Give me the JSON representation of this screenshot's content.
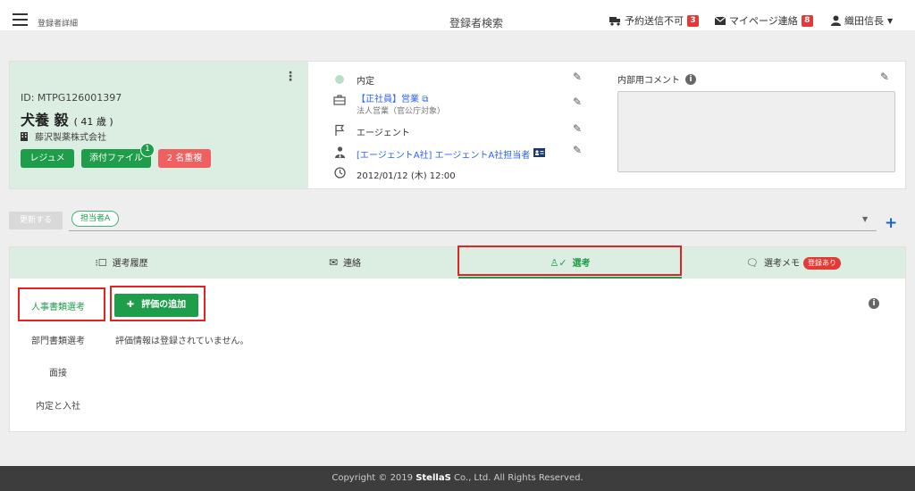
{
  "header": {
    "breadcrumb": "登録者詳細",
    "center_title": "登録者検索",
    "reservation_label": "予約送信不可",
    "reservation_count": "3",
    "mypage_label": "マイページ連絡",
    "mypage_count": "8",
    "user_name": "織田信長"
  },
  "profile": {
    "id": "ID: MTPG126001397",
    "name": "犬養 毅",
    "age": "( 41 歳 )",
    "company": "藤沢製薬株式会社",
    "resume_button": "レジュメ",
    "attachment_button": "添付ファイル",
    "attachment_count": "1",
    "duplicate_button": "2 名重複"
  },
  "meta": {
    "status": "内定",
    "job_title": "【正社員】営業",
    "job_sub": "法人営業（官公庁対象）",
    "route": "エージェント",
    "agent": "[エージェントA社] エージェントA社担当者",
    "datetime": "2012/01/12 (木) 12:00"
  },
  "comment": {
    "title": "内部用コメント",
    "value": ""
  },
  "assign": {
    "update_button": "更新する",
    "tag": "担当者A"
  },
  "tabs": {
    "history": "選考履歴",
    "contact": "連絡",
    "selection": "選考",
    "memo": "選考メモ",
    "memo_badge": "登録あり"
  },
  "selection": {
    "stages": [
      "人事書類選考",
      "部門書類選考",
      "面接",
      "内定と入社"
    ],
    "add_button": "評価の追加",
    "empty_message": "評価情報は登録されていません。"
  },
  "footer": {
    "prefix": "Copyright © 2019 ",
    "brand": "StellaS",
    "suffix": " Co., Ltd. All Rights Reserved."
  },
  "colors": {
    "accent": "#1e9d4a",
    "panel": "#dcede2",
    "highlight": "#e52222",
    "badge": "#e53935"
  }
}
